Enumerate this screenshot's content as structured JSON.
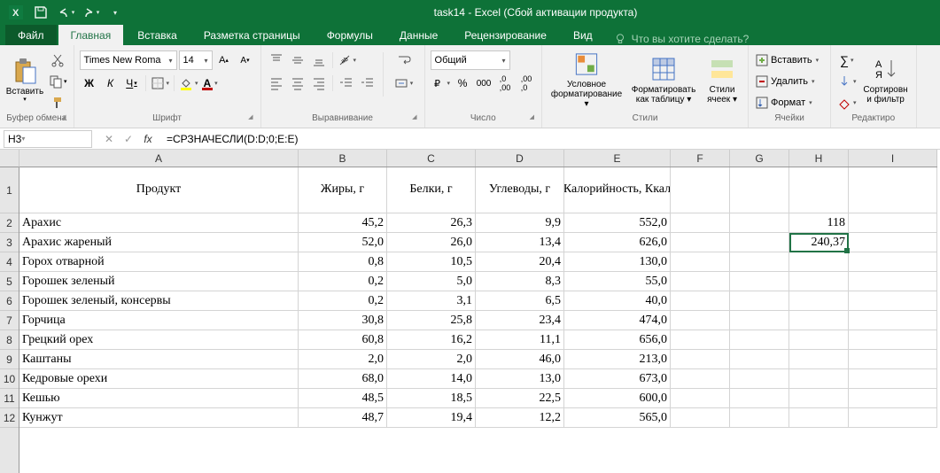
{
  "title": "task14 - Excel (Сбой активации продукта)",
  "tabs": {
    "file": "Файл",
    "home": "Главная",
    "insert": "Вставка",
    "layout": "Разметка страницы",
    "formulas": "Формулы",
    "data": "Данные",
    "review": "Рецензирование",
    "view": "Вид"
  },
  "tellme": "Что вы хотите сделать?",
  "groups": {
    "clipboard": "Буфер обмена",
    "font": "Шрифт",
    "alignment": "Выравнивание",
    "number": "Число",
    "styles": "Стили",
    "cells": "Ячейки",
    "editing": "Редактиро"
  },
  "ribbon": {
    "paste": "Вставить",
    "font_name": "Times New Roma",
    "font_size": "14",
    "number_format": "Общий",
    "cond_fmt1": "Условное",
    "cond_fmt2": "форматирование",
    "fmt_table1": "Форматировать",
    "fmt_table2": "как таблицу",
    "cell_styles1": "Стили",
    "cell_styles2": "ячеек",
    "insert": "Вставить",
    "delete": "Удалить",
    "format": "Формат",
    "sort1": "Сортировн",
    "sort2": "и фильтр"
  },
  "namebox": "H3",
  "formula": "=СРЗНАЧЕСЛИ(D:D;0;E:E)",
  "cols": [
    "A",
    "B",
    "C",
    "D",
    "E",
    "F",
    "G",
    "H",
    "I"
  ],
  "rownums": [
    "1",
    "2",
    "3",
    "4",
    "5",
    "6",
    "7",
    "8",
    "9",
    "10",
    "11",
    "12"
  ],
  "headers": {
    "A": "Продукт",
    "B": "Жиры, г",
    "C": "Белки, г",
    "D": "Углеводы, г",
    "E": "Калорийность, Ккал"
  },
  "rows": [
    {
      "A": "Арахис",
      "B": "45,2",
      "C": "26,3",
      "D": "9,9",
      "E": "552,0",
      "H": "118"
    },
    {
      "A": "Арахис жареный",
      "B": "52,0",
      "C": "26,0",
      "D": "13,4",
      "E": "626,0",
      "H": "240,37"
    },
    {
      "A": "Горох отварной",
      "B": "0,8",
      "C": "10,5",
      "D": "20,4",
      "E": "130,0"
    },
    {
      "A": "Горошек зеленый",
      "B": "0,2",
      "C": "5,0",
      "D": "8,3",
      "E": "55,0"
    },
    {
      "A": "Горошек зеленый, консервы",
      "B": "0,2",
      "C": "3,1",
      "D": "6,5",
      "E": "40,0"
    },
    {
      "A": "Горчица",
      "B": "30,8",
      "C": "25,8",
      "D": "23,4",
      "E": "474,0"
    },
    {
      "A": "Грецкий орех",
      "B": "60,8",
      "C": "16,2",
      "D": "11,1",
      "E": "656,0"
    },
    {
      "A": "Каштаны",
      "B": "2,0",
      "C": "2,0",
      "D": "46,0",
      "E": "213,0"
    },
    {
      "A": "Кедровые орехи",
      "B": "68,0",
      "C": "14,0",
      "D": "13,0",
      "E": "673,0"
    },
    {
      "A": "Кешью",
      "B": "48,5",
      "C": "18,5",
      "D": "22,5",
      "E": "600,0"
    },
    {
      "A": "Кунжут",
      "B": "48,7",
      "C": "19,4",
      "D": "12,2",
      "E": "565,0"
    }
  ],
  "selected_cell": "H3"
}
